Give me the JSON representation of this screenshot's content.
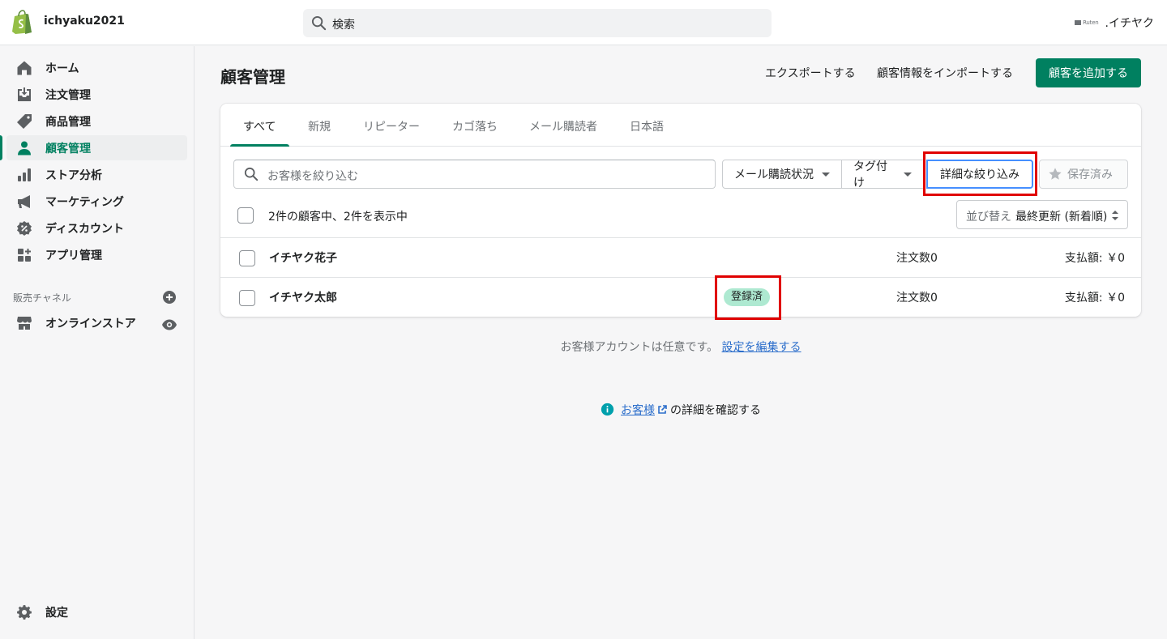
{
  "topbar": {
    "store_name": "ichyaku2021",
    "search_placeholder": "検索",
    "account_small": "Ruten",
    "account_name": ".イチヤク"
  },
  "sidebar": {
    "items": [
      {
        "label": "ホーム",
        "icon": "home-icon"
      },
      {
        "label": "注文管理",
        "icon": "orders-icon"
      },
      {
        "label": "商品管理",
        "icon": "tag-icon"
      },
      {
        "label": "顧客管理",
        "icon": "customer-icon",
        "active": true
      },
      {
        "label": "ストア分析",
        "icon": "analytics-icon"
      },
      {
        "label": "マーケティング",
        "icon": "megaphone-icon"
      },
      {
        "label": "ディスカウント",
        "icon": "discount-icon"
      },
      {
        "label": "アプリ管理",
        "icon": "apps-icon"
      }
    ],
    "sales_channels_title": "販売チャネル",
    "online_store": "オンラインストア",
    "settings": "設定"
  },
  "page": {
    "title": "顧客管理",
    "export": "エクスポートする",
    "import": "顧客情報をインポートする",
    "add_customer": "顧客を追加する"
  },
  "tabs": [
    "すべて",
    "新規",
    "リピーター",
    "カゴ落ち",
    "メール購読者",
    "日本語"
  ],
  "filters": {
    "search_placeholder": "お客様を絞り込む",
    "email_status": "メール購読状況",
    "tagged": "タグ付け",
    "more_filters": "詳細な絞り込み",
    "saved": "保存済み"
  },
  "list": {
    "count_text": "2件の顧客中、2件を表示中",
    "sort_label": "並び替え",
    "sort_value": "最終更新 (新着順)",
    "rows": [
      {
        "name": "イチヤク花子",
        "badge": "",
        "orders": "注文数0",
        "spent": "支払額: ￥0"
      },
      {
        "name": "イチヤク太郎",
        "badge": "登録済",
        "orders": "注文数0",
        "spent": "支払額: ￥0"
      }
    ]
  },
  "footer": {
    "account_note": "お客様アカウントは任意です。",
    "edit_settings_link": "設定を編集する",
    "learn_link": "お客様",
    "learn_suffix": "の詳細を確認する"
  },
  "colors": {
    "accent": "#008060",
    "highlight_box": "#e00000",
    "badge_bg": "#aee9d1",
    "link": "#2c6ecb"
  }
}
